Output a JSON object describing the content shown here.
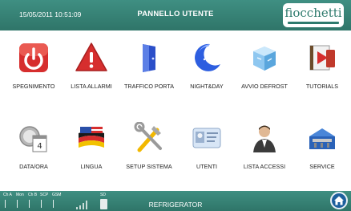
{
  "header": {
    "datetime": "15/05/2011 10:51:09",
    "title": "PANNELLO UTENTE",
    "logo_text": "fiocchetti"
  },
  "tiles": [
    {
      "label": "SPEGNIMENTO",
      "icon": "power-icon"
    },
    {
      "label": "LISTA ALLARMI",
      "icon": "alarm-warning-icon"
    },
    {
      "label": "TRAFFICO PORTA",
      "icon": "door-icon"
    },
    {
      "label": "NIGHT&DAY",
      "icon": "moon-icon"
    },
    {
      "label": "AVVIO DEFROST",
      "icon": "ice-cube-icon"
    },
    {
      "label": "TUTORIALS",
      "icon": "video-tutorial-icon"
    },
    {
      "label": "DATA/ORA",
      "icon": "clock-calendar-icon"
    },
    {
      "label": "LINGUA",
      "icon": "flags-icon"
    },
    {
      "label": "SETUP SISTEMA",
      "icon": "tools-icon"
    },
    {
      "label": "UTENTI",
      "icon": "id-card-icon"
    },
    {
      "label": "LISTA ACCESSI",
      "icon": "user-icon"
    },
    {
      "label": "SERVICE",
      "icon": "toolbox-icon"
    }
  ],
  "statusbar": {
    "indicators": [
      "Ch A",
      "Mon",
      "Ch B",
      "SCP",
      "GSM",
      "SD"
    ],
    "mode": "REFRIGERATOR"
  },
  "colors": {
    "bar": "#2f7569",
    "accent": "#d62e2e"
  }
}
